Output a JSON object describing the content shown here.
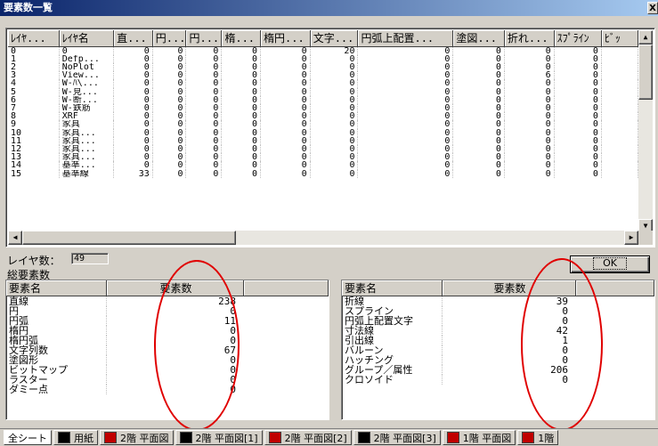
{
  "window": {
    "title": "要素数一覧",
    "close_label": "X"
  },
  "grid": {
    "columns": [
      "ﾚｲﾔ...",
      "ﾚｲﾔ名",
      "直...",
      "円...",
      "円...",
      "楕...",
      "楕円...",
      "文字...",
      "円弧上配置...",
      "塗図...",
      "折れ...",
      "ｽﾌﾟﾗｲﾝ",
      "ﾋﾞｯ"
    ],
    "rows": [
      [
        "0",
        "0",
        "0",
        "0",
        "0",
        "0",
        "0",
        "20",
        "0",
        "0",
        "0",
        "0",
        ""
      ],
      [
        "1",
        "Defp...",
        "0",
        "0",
        "0",
        "0",
        "0",
        "0",
        "0",
        "0",
        "0",
        "0",
        ""
      ],
      [
        "2",
        "NoPlot",
        "0",
        "0",
        "0",
        "0",
        "0",
        "0",
        "0",
        "0",
        "0",
        "0",
        ""
      ],
      [
        "3",
        "View...",
        "0",
        "0",
        "0",
        "0",
        "0",
        "0",
        "0",
        "0",
        "6",
        "0",
        ""
      ],
      [
        "4",
        "W-ﾊ\\...",
        "0",
        "0",
        "0",
        "0",
        "0",
        "0",
        "0",
        "0",
        "0",
        "0",
        ""
      ],
      [
        "5",
        "W-見...",
        "0",
        "0",
        "0",
        "0",
        "0",
        "0",
        "0",
        "0",
        "0",
        "0",
        ""
      ],
      [
        "6",
        "W-断...",
        "0",
        "0",
        "0",
        "0",
        "0",
        "0",
        "0",
        "0",
        "0",
        "0",
        ""
      ],
      [
        "7",
        "W-鉄筋",
        "0",
        "0",
        "0",
        "0",
        "0",
        "0",
        "0",
        "0",
        "0",
        "0",
        ""
      ],
      [
        "8",
        "XRF",
        "0",
        "0",
        "0",
        "0",
        "0",
        "0",
        "0",
        "0",
        "0",
        "0",
        ""
      ],
      [
        "9",
        "家具",
        "0",
        "0",
        "0",
        "0",
        "0",
        "0",
        "0",
        "0",
        "0",
        "0",
        ""
      ],
      [
        "10",
        "家具...",
        "0",
        "0",
        "0",
        "0",
        "0",
        "0",
        "0",
        "0",
        "0",
        "0",
        ""
      ],
      [
        "11",
        "家具...",
        "0",
        "0",
        "0",
        "0",
        "0",
        "0",
        "0",
        "0",
        "0",
        "0",
        ""
      ],
      [
        "12",
        "家具...",
        "0",
        "0",
        "0",
        "0",
        "0",
        "0",
        "0",
        "0",
        "0",
        "0",
        ""
      ],
      [
        "13",
        "家具...",
        "0",
        "0",
        "0",
        "0",
        "0",
        "0",
        "0",
        "0",
        "0",
        "0",
        ""
      ],
      [
        "14",
        "基準...",
        "0",
        "0",
        "0",
        "0",
        "0",
        "0",
        "0",
        "0",
        "0",
        "0",
        ""
      ],
      [
        "15",
        "基準線",
        "33",
        "0",
        "0",
        "0",
        "0",
        "0",
        "0",
        "0",
        "0",
        "0",
        ""
      ]
    ]
  },
  "layer_count": {
    "label": "レイヤ数：",
    "value": "49"
  },
  "ok_label": "OK",
  "total_label": "総要素数",
  "summary_left": {
    "headers": [
      "要素名",
      "要素数"
    ],
    "rows": [
      [
        "直線",
        "238"
      ],
      [
        "円",
        "0"
      ],
      [
        "円弧",
        "11"
      ],
      [
        "楕円",
        "0"
      ],
      [
        "楕円弧",
        "0"
      ],
      [
        "文字列数",
        "67"
      ],
      [
        "塗図形",
        "0"
      ],
      [
        "ビットマップ",
        "0"
      ],
      [
        "ラスター",
        "0"
      ],
      [
        "ダミー点",
        "0"
      ]
    ]
  },
  "summary_right": {
    "headers": [
      "要素名",
      "要素数"
    ],
    "rows": [
      [
        "折線",
        "39"
      ],
      [
        "スプライン",
        "0"
      ],
      [
        "円弧上配置文字",
        "0"
      ],
      [
        "寸法線",
        "42"
      ],
      [
        "引出線",
        "1"
      ],
      [
        "バルーン",
        "0"
      ],
      [
        "ハッチング",
        "0"
      ],
      [
        "グループ／属性",
        "206"
      ],
      [
        "クロソイド",
        "0"
      ]
    ]
  },
  "sheet_tabs": [
    {
      "label": "全シート",
      "swatch": ""
    },
    {
      "label": "用紙",
      "swatch": "#000000"
    },
    {
      "label": "2階 平面図",
      "swatch": "#c00000"
    },
    {
      "label": "2階 平面図[1]",
      "swatch": "#000000"
    },
    {
      "label": "2階 平面図[2]",
      "swatch": "#c00000"
    },
    {
      "label": "2階 平面図[3]",
      "swatch": "#000000"
    },
    {
      "label": "1階 平面図",
      "swatch": "#c00000"
    },
    {
      "label": "1階",
      "swatch": "#c00000"
    }
  ],
  "colors": {
    "title_bar": "#0a246a",
    "annotation": "#e00000",
    "face": "#d4d0c8"
  }
}
